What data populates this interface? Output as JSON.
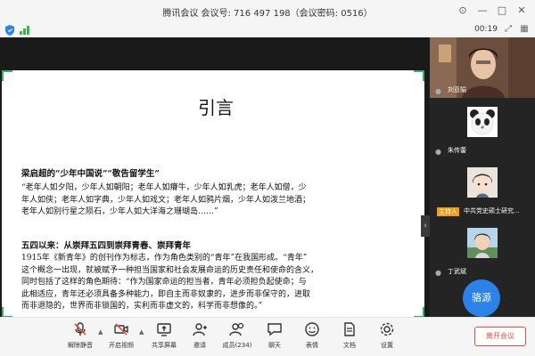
{
  "window": {
    "title": "腾讯会议 会议号: 716 497 198（会议密码: 0516）"
  },
  "status": {
    "timer": "00:19"
  },
  "slide": {
    "title": "引言",
    "section1_heading": "梁启超的“少年中国说”“敬告留学生”",
    "section1_lines": [
      "“老年人如夕阳，少年人如朝阳；老年人如瘠牛，少年人如乳虎；老年人如僧，少",
      "年人如侠；老年人如字典，少年人如戏文；老年人如鸦片烟，少年人如泼兰地酒；",
      "老年人如别行星之陨石，少年人如大洋海之珊瑚岛……”"
    ],
    "section2_heading": "五四以来：从崇拜五四到崇拜青春、崇拜青年",
    "section2_lines": [
      "1915年《新青年》的创刊作为标志，作为角色类别的“青年”在我国形成。“青年”",
      "这个概念一出现，就被赋予一种担当国家和社会发展命运的历史责任和使命的含义，",
      "同时包括了这样的角色期待：“作为国家命运的担当者，青年必须担负起使命；与",
      "此相适应，青年还必须具备多种能力，即自主而非奴隶的，进步而非保守的，进取",
      "而非退隐的，世界而非锁国的，实利而非虚文的，科学而非想像的。”"
    ]
  },
  "participants": [
    {
      "name": "刘亚娟",
      "host": false
    },
    {
      "name": "朱传蕾",
      "host": false
    },
    {
      "name": "中共党史硕士研究...",
      "host": true,
      "badge": "主持人"
    },
    {
      "name": "丁武斌",
      "host": false
    },
    {
      "name": "骆源",
      "avatar_text": "骆源"
    }
  ],
  "toolbar": {
    "mute": "解除静音",
    "video": "开启视频",
    "share": "共享屏幕",
    "invite": "邀请",
    "members": "成员(234)",
    "chat": "聊天",
    "reactions": "表情",
    "docs": "文档",
    "settings": "设置",
    "end": "离开会议"
  },
  "colors": {
    "accent_green": "#38b068",
    "host_orange": "#f39c12",
    "end_red": "#e54d42",
    "avatar_blue": "#2c82ea"
  }
}
